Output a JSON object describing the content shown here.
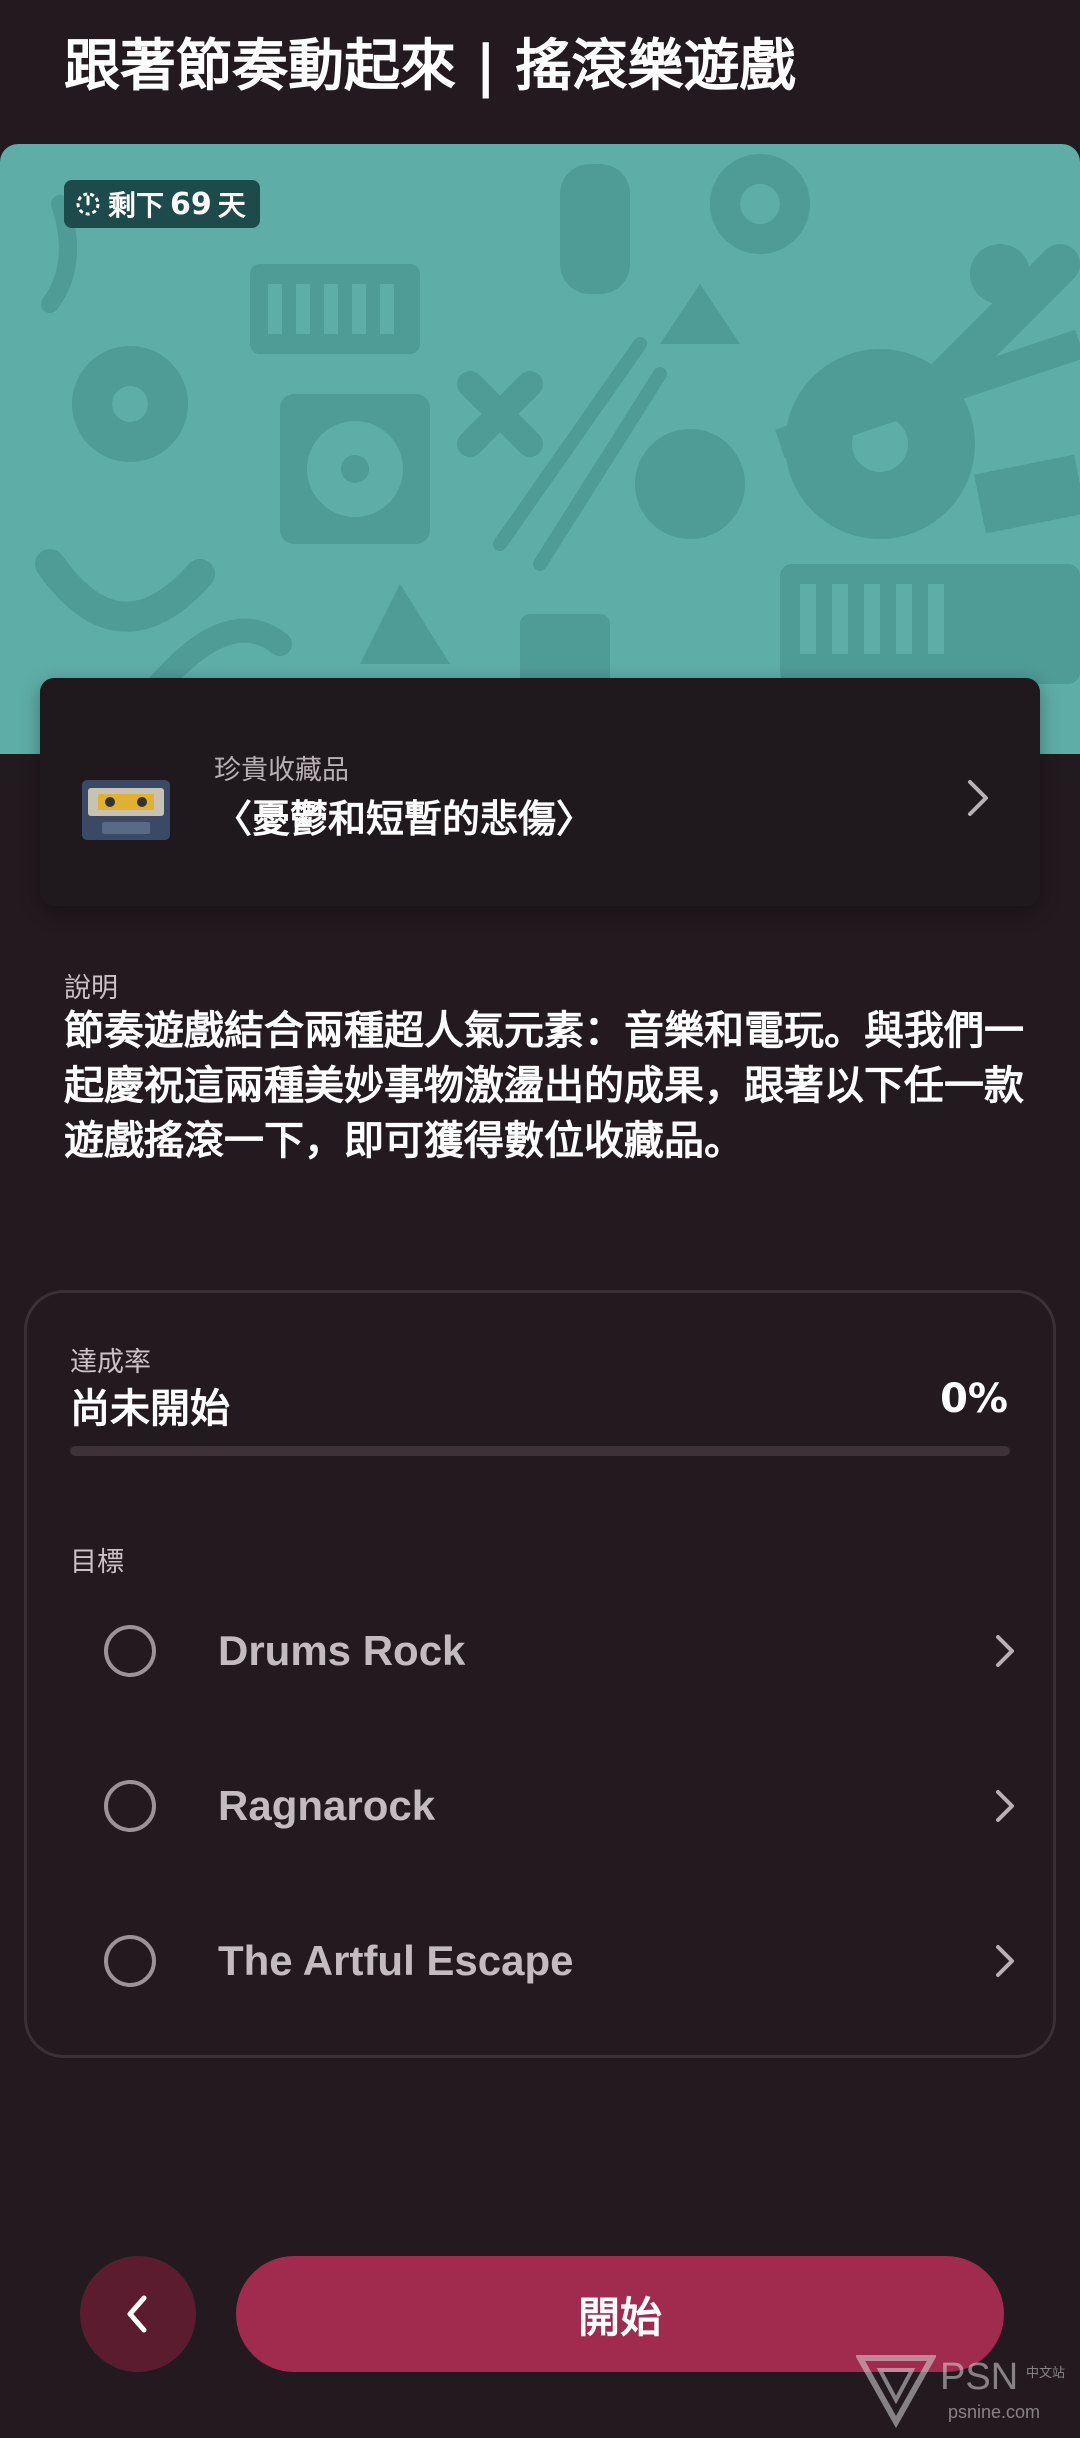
{
  "header": {
    "title": "跟著節奏動起來 | 搖滾樂遊戲"
  },
  "hero": {
    "days_prefix": "剩下",
    "days_count": "69",
    "days_suffix": "天",
    "pattern_color": "#4f9b95",
    "background_color": "#5fada7"
  },
  "reward": {
    "label": "珍貴收藏品",
    "name": "〈憂鬱和短暫的悲傷〉",
    "icon": "cassette-tape-icon"
  },
  "description": {
    "label": "說明",
    "text": "節奏遊戲結合兩種超人氣元素：音樂和電玩。與我們一起慶祝這兩種美妙事物激盪出的成果，跟著以下任一款遊戲搖滾一下，即可獲得數位收藏品。"
  },
  "progress": {
    "label": "達成率",
    "status": "尚未開始",
    "percent_text": "0%",
    "fraction": 0
  },
  "goals": {
    "label": "目標",
    "items": [
      {
        "name": "Drums Rock",
        "completed": false
      },
      {
        "name": "Ragnarock",
        "completed": false
      },
      {
        "name": "The Artful Escape",
        "completed": false
      }
    ]
  },
  "footer": {
    "back_icon": "chevron-left-icon",
    "start_label": "開始"
  },
  "watermark": {
    "brand": "PSN",
    "sub": "中文站",
    "url": "psnine.com"
  },
  "colors": {
    "accent": "#a12a4f",
    "background": "#231a1f",
    "card": "#1f181c"
  }
}
